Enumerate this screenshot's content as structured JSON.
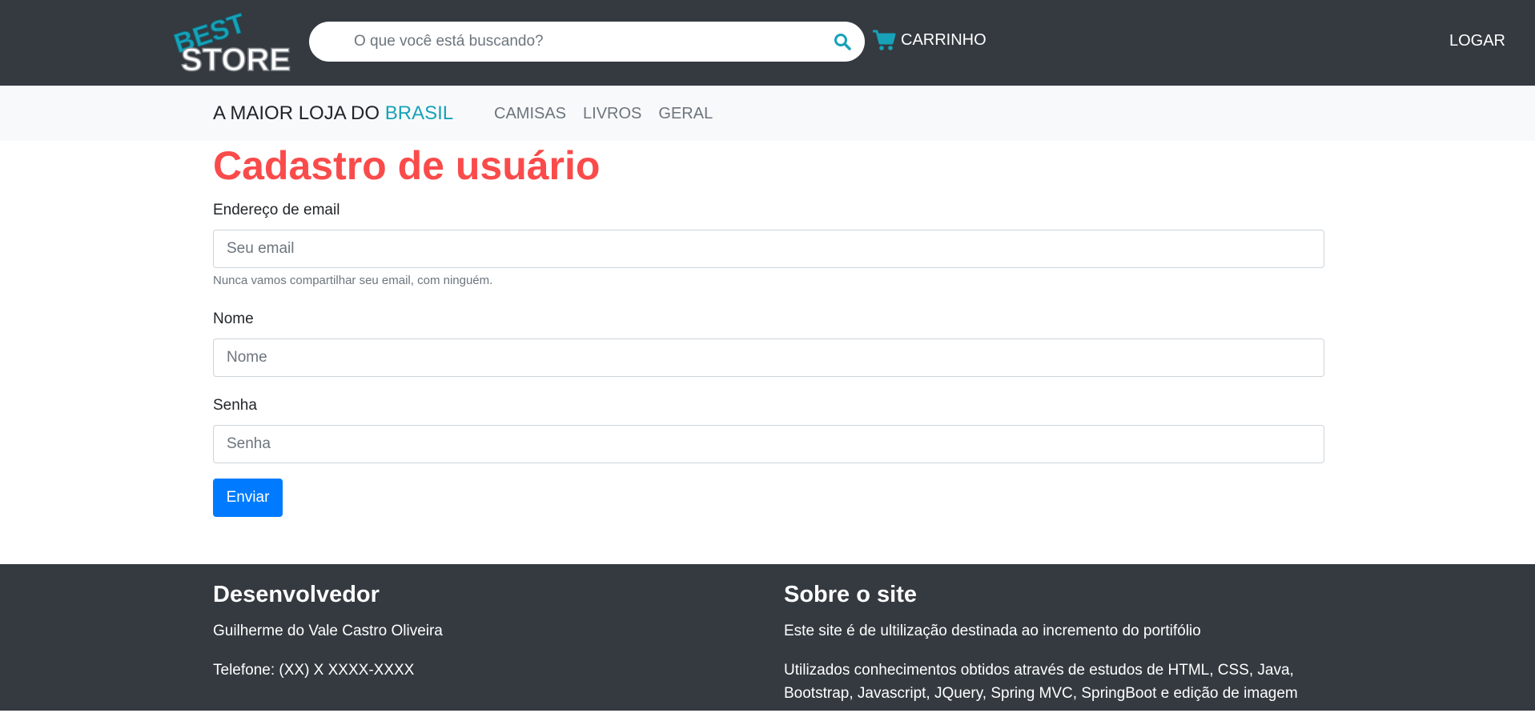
{
  "header": {
    "logo": {
      "line1": "BEST",
      "line2": "STORE"
    },
    "search": {
      "placeholder": "O que você está buscando?"
    },
    "cart_label": "CARRINHO",
    "login_label": "LOGAR",
    "colors": {
      "background": "#343a40",
      "accent": "#17a2b8"
    }
  },
  "subnav": {
    "brand_prefix": "A MAIOR LOJA DO",
    "brand_highlight": "BRASIL",
    "links": [
      "CAMISAS",
      "LIVROS",
      "GERAL"
    ]
  },
  "form": {
    "title": "Cadastro de usuário",
    "email": {
      "label": "Endereço de email",
      "placeholder": "Seu email",
      "help": "Nunca vamos compartilhar seu email, com ninguém."
    },
    "name": {
      "label": "Nome",
      "placeholder": "Nome"
    },
    "password": {
      "label": "Senha",
      "placeholder": "Senha"
    },
    "submit_label": "Enviar",
    "colors": {
      "title": "#fa4b4b",
      "button": "#007bff"
    }
  },
  "footer": {
    "developer": {
      "heading": "Desenvolvedor",
      "name": "Guilherme do Vale Castro Oliveira",
      "phone": "Telefone: (XX) X XXXX-XXXX"
    },
    "about": {
      "heading": "Sobre o site",
      "line1": "Este site é de ultilização destinada ao incremento do portifólio",
      "line2": "Utilizados conhecimentos obtidos através de estudos de HTML, CSS, Java, Bootstrap, Javascript, JQuery, Spring MVC, SpringBoot e edição de imagem"
    }
  }
}
